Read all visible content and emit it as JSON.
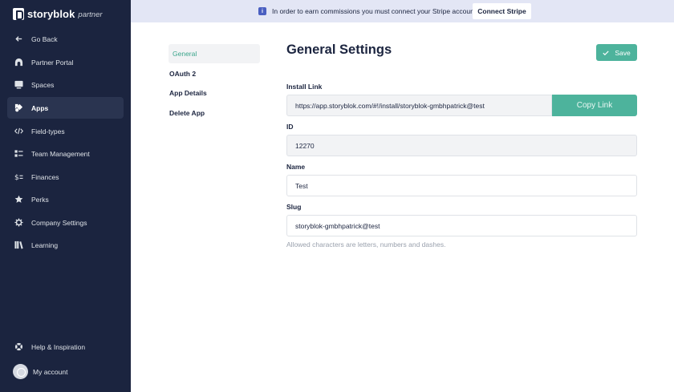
{
  "brand": {
    "name": "storyblok",
    "sub": "partner"
  },
  "sidebar": {
    "items": [
      {
        "label": "Go Back",
        "icon": "arrow-left-icon"
      },
      {
        "label": "Partner Portal",
        "icon": "portal-icon"
      },
      {
        "label": "Spaces",
        "icon": "monitor-icon"
      },
      {
        "label": "Apps",
        "icon": "apps-icon",
        "active": true
      },
      {
        "label": "Field-types",
        "icon": "code-icon"
      },
      {
        "label": "Team Management",
        "icon": "team-icon"
      },
      {
        "label": "Finances",
        "icon": "dollar-icon"
      },
      {
        "label": "Perks",
        "icon": "star-icon"
      },
      {
        "label": "Company Settings",
        "icon": "gear-icon"
      },
      {
        "label": "Learning",
        "icon": "books-icon"
      }
    ],
    "help": {
      "label": "Help & Inspiration",
      "icon": "lifebuoy-icon"
    },
    "account": {
      "label": "My account"
    }
  },
  "banner": {
    "text": "In order to earn commissions you must connect your Stripe account",
    "button": "Connect Stripe"
  },
  "subnav": [
    {
      "label": "General",
      "active": true
    },
    {
      "label": "OAuth 2"
    },
    {
      "label": "App Details"
    },
    {
      "label": "Delete App"
    }
  ],
  "main": {
    "title": "General Settings",
    "save_label": "Save",
    "install_link": {
      "label": "Install Link",
      "value": "https://app.storyblok.com/#!/install/storyblok-gmbhpatrick@test",
      "copy_label": "Copy Link"
    },
    "id": {
      "label": "ID",
      "value": "12270"
    },
    "name": {
      "label": "Name",
      "value": "Test"
    },
    "slug": {
      "label": "Slug",
      "value": "storyblok-gmbhpatrick@test",
      "help": "Allowed characters are letters, numbers and dashes."
    }
  },
  "colors": {
    "sidebar": "#1b243f",
    "accent": "#4db39c",
    "banner": "#e3e6f5",
    "info": "#4a5fc1"
  }
}
